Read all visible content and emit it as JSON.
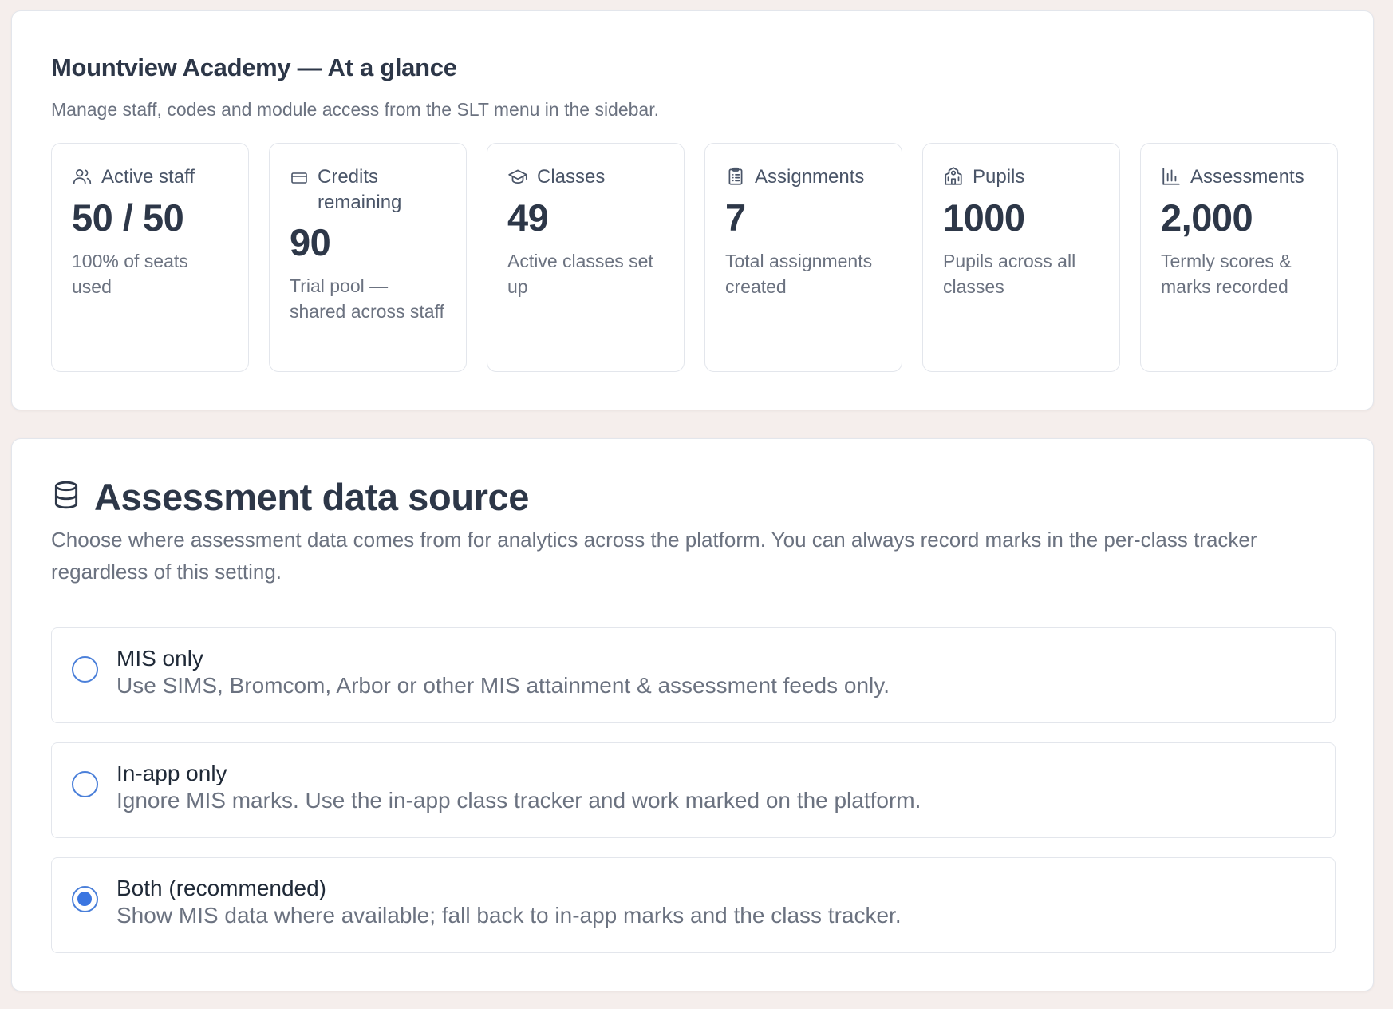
{
  "overview": {
    "title": "Mountview Academy — At a glance",
    "subtitle": "Manage staff, codes and module access from the SLT menu in the sidebar.",
    "stats": [
      {
        "icon": "users-icon",
        "label": "Active staff",
        "value": "50 / 50",
        "description": "100% of seats used"
      },
      {
        "icon": "credit-card-icon",
        "label": "Credits remaining",
        "value": "90",
        "description": "Trial pool — shared across staff"
      },
      {
        "icon": "graduation-cap-icon",
        "label": "Classes",
        "value": "49",
        "description": "Active classes set up"
      },
      {
        "icon": "clipboard-list-icon",
        "label": "Assignments",
        "value": "7",
        "description": "Total assignments created"
      },
      {
        "icon": "school-icon",
        "label": "Pupils",
        "value": "1000",
        "description": "Pupils across all classes"
      },
      {
        "icon": "bar-chart-icon",
        "label": "Assessments",
        "value": "2,000",
        "description": "Termly scores & marks recorded"
      }
    ]
  },
  "data_source": {
    "icon": "database-icon",
    "title": "Assessment data source",
    "description": "Choose where assessment data comes from for analytics across the platform. You can always record marks in the per-class tracker regardless of this setting.",
    "selected": "both",
    "options": [
      {
        "id": "mis",
        "title": "MIS only",
        "description": "Use SIMS, Bromcom, Arbor or other MIS attainment & assessment feeds only."
      },
      {
        "id": "inapp",
        "title": "In-app only",
        "description": "Ignore MIS marks. Use the in-app class tracker and work marked on the platform."
      },
      {
        "id": "both",
        "title": "Both (recommended)",
        "description": "Show MIS data where available; fall back to in-app marks and the class tracker."
      }
    ]
  },
  "colors": {
    "background": "#f5eeec",
    "accent": "#3b76e1",
    "heading": "#2d3748",
    "muted": "#6b7280"
  }
}
